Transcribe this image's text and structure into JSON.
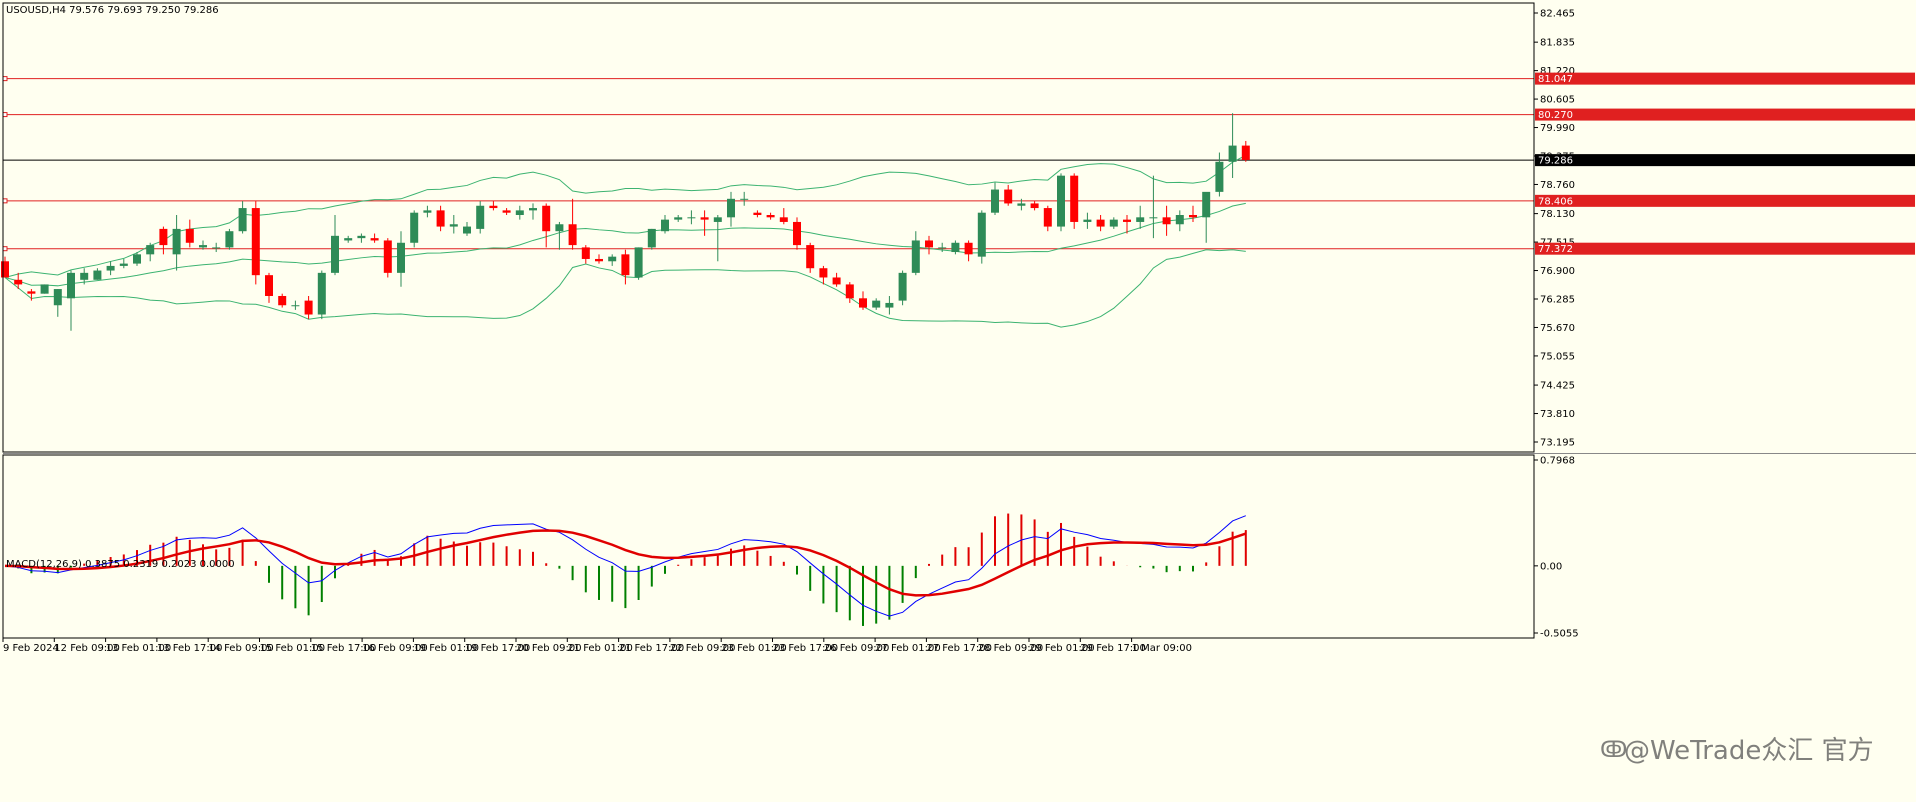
{
  "window": {
    "header": "USOUSD,H4  79.576 79.693 79.250 79.286",
    "macd_header": "MACD(12,26,9) 0.3875 0.2319 0.2023 0.0000",
    "watermark": "@WeTrade众汇 官方"
  },
  "colors": {
    "background": "#fffff0",
    "bull_candle": "#2e8b57",
    "bear_candle": "#ff0000",
    "bands": "#3cb371",
    "level_line": "#e02020",
    "macd_line": "#0000ff",
    "signal_line": "#e00000",
    "histogram_pos": "#e00000",
    "histogram_neg": "#008000"
  },
  "chart_data": [
    {
      "type": "candlestick",
      "symbol": "USOUSD",
      "timeframe": "H4",
      "ohlc_last": {
        "open": 79.576,
        "high": 79.693,
        "low": 79.25,
        "close": 79.286
      },
      "y_ticks": [
        "82.465",
        "81.835",
        "81.220",
        "80.605",
        "79.990",
        "79.375",
        "78.760",
        "78.130",
        "77.515",
        "76.900",
        "76.285",
        "75.670",
        "75.055",
        "74.425",
        "73.810",
        "73.195"
      ],
      "ylim": [
        73.195,
        82.465
      ],
      "price_labels": [
        {
          "label": "81.047",
          "value": 81.047,
          "kind": "level"
        },
        {
          "label": "80.270",
          "value": 80.27,
          "kind": "level"
        },
        {
          "label": "79.286",
          "value": 79.286,
          "kind": "current"
        },
        {
          "label": "78.406",
          "value": 78.406,
          "kind": "level"
        },
        {
          "label": "77.372",
          "value": 77.372,
          "kind": "level"
        }
      ],
      "x_labels": [
        "9 Feb 2024",
        "12 Feb 09:00",
        "13 Feb 01:00",
        "13 Feb 17:00",
        "14 Feb 09:00",
        "15 Feb 01:00",
        "15 Feb 17:00",
        "16 Feb 09:00",
        "19 Feb 01:00",
        "19 Feb 17:00",
        "20 Feb 09:00",
        "21 Feb 01:00",
        "21 Feb 17:00",
        "22 Feb 09:00",
        "23 Feb 01:00",
        "23 Feb 17:00",
        "26 Feb 09:00",
        "27 Feb 01:00",
        "27 Feb 17:00",
        "28 Feb 09:00",
        "29 Feb 01:00",
        "29 Feb 17:00",
        "1 Mar 09:00"
      ],
      "candles": [
        [
          77.1,
          77.2,
          76.75,
          76.75
        ],
        [
          76.7,
          76.85,
          76.5,
          76.6
        ],
        [
          76.45,
          76.5,
          76.25,
          76.4
        ],
        [
          76.4,
          76.6,
          76.4,
          76.6
        ],
        [
          76.15,
          76.5,
          75.9,
          76.5
        ],
        [
          76.3,
          76.9,
          75.6,
          76.85
        ],
        [
          76.7,
          76.95,
          76.6,
          76.85
        ],
        [
          76.7,
          76.95,
          76.7,
          76.9
        ],
        [
          76.9,
          77.1,
          76.8,
          77.0
        ],
        [
          77.0,
          77.15,
          76.95,
          77.05
        ],
        [
          77.05,
          77.3,
          77.0,
          77.25
        ],
        [
          77.25,
          77.5,
          77.1,
          77.45
        ],
        [
          77.8,
          77.85,
          77.25,
          77.45
        ],
        [
          77.25,
          78.1,
          76.9,
          77.8
        ],
        [
          77.8,
          78.0,
          77.4,
          77.5
        ],
        [
          77.4,
          77.55,
          77.35,
          77.45
        ],
        [
          77.4,
          77.5,
          77.3,
          77.4
        ],
        [
          77.4,
          77.8,
          77.35,
          77.75
        ],
        [
          77.75,
          78.4,
          77.7,
          78.25
        ],
        [
          78.25,
          78.4,
          76.6,
          76.8
        ],
        [
          76.8,
          76.85,
          76.2,
          76.35
        ],
        [
          76.35,
          76.4,
          76.1,
          76.15
        ],
        [
          76.15,
          76.25,
          76.05,
          76.15
        ],
        [
          76.25,
          76.35,
          75.85,
          75.95
        ],
        [
          75.95,
          76.9,
          75.85,
          76.85
        ],
        [
          76.85,
          78.1,
          76.8,
          77.65
        ],
        [
          77.55,
          77.65,
          77.5,
          77.6
        ],
        [
          77.6,
          77.7,
          77.5,
          77.65
        ],
        [
          77.6,
          77.7,
          77.5,
          77.55
        ],
        [
          77.55,
          77.6,
          76.75,
          76.85
        ],
        [
          76.85,
          77.75,
          76.55,
          77.5
        ],
        [
          77.5,
          78.2,
          77.4,
          78.15
        ],
        [
          78.15,
          78.3,
          78.05,
          78.2
        ],
        [
          78.2,
          78.3,
          77.75,
          77.85
        ],
        [
          77.85,
          78.1,
          77.7,
          77.9
        ],
        [
          77.7,
          77.95,
          77.65,
          77.85
        ],
        [
          77.8,
          78.4,
          77.7,
          78.3
        ],
        [
          78.3,
          78.4,
          78.2,
          78.25
        ],
        [
          78.2,
          78.25,
          78.1,
          78.15
        ],
        [
          78.1,
          78.3,
          78.0,
          78.2
        ],
        [
          78.2,
          78.35,
          78.0,
          78.25
        ],
        [
          78.3,
          78.35,
          77.4,
          77.75
        ],
        [
          77.75,
          77.95,
          77.35,
          77.9
        ],
        [
          77.9,
          78.45,
          77.35,
          77.45
        ],
        [
          77.4,
          77.45,
          77.05,
          77.15
        ],
        [
          77.15,
          77.25,
          77.05,
          77.1
        ],
        [
          77.1,
          77.25,
          77.0,
          77.2
        ],
        [
          77.25,
          77.35,
          76.6,
          76.8
        ],
        [
          76.75,
          77.4,
          76.7,
          77.4
        ],
        [
          77.4,
          77.8,
          77.35,
          77.8
        ],
        [
          77.75,
          78.1,
          77.7,
          78.0
        ],
        [
          78.0,
          78.1,
          77.95,
          78.05
        ],
        [
          78.05,
          78.2,
          77.9,
          78.05
        ],
        [
          78.05,
          78.2,
          77.65,
          78.0
        ],
        [
          77.95,
          78.1,
          77.1,
          78.05
        ],
        [
          78.05,
          78.6,
          77.85,
          78.45
        ],
        [
          78.45,
          78.6,
          78.3,
          78.45
        ],
        [
          78.15,
          78.2,
          78.05,
          78.1
        ],
        [
          78.1,
          78.15,
          78.0,
          78.05
        ],
        [
          78.05,
          78.25,
          77.9,
          77.95
        ],
        [
          77.95,
          78.05,
          77.35,
          77.45
        ],
        [
          77.45,
          77.5,
          76.85,
          76.95
        ],
        [
          76.95,
          77.0,
          76.6,
          76.75
        ],
        [
          76.75,
          76.85,
          76.55,
          76.6
        ],
        [
          76.6,
          76.65,
          76.2,
          76.3
        ],
        [
          76.3,
          76.45,
          76.05,
          76.1
        ],
        [
          76.1,
          76.3,
          76.05,
          76.25
        ],
        [
          76.1,
          76.35,
          75.95,
          76.2
        ],
        [
          76.25,
          76.9,
          76.15,
          76.85
        ],
        [
          76.85,
          77.75,
          76.8,
          77.55
        ],
        [
          77.55,
          77.65,
          77.25,
          77.4
        ],
        [
          77.4,
          77.5,
          77.3,
          77.4
        ],
        [
          77.3,
          77.55,
          77.25,
          77.5
        ],
        [
          77.5,
          77.55,
          77.1,
          77.25
        ],
        [
          77.2,
          78.2,
          77.05,
          78.15
        ],
        [
          78.15,
          78.8,
          78.1,
          78.65
        ],
        [
          78.65,
          78.75,
          78.3,
          78.35
        ],
        [
          78.3,
          78.45,
          78.2,
          78.35
        ],
        [
          78.35,
          78.4,
          78.2,
          78.25
        ],
        [
          78.25,
          78.3,
          77.75,
          77.85
        ],
        [
          77.85,
          79.0,
          77.75,
          78.95
        ],
        [
          78.95,
          79.0,
          77.8,
          77.95
        ],
        [
          77.95,
          78.15,
          77.8,
          78.0
        ],
        [
          78.0,
          78.1,
          77.75,
          77.85
        ],
        [
          77.85,
          78.05,
          77.8,
          78.0
        ],
        [
          78.0,
          78.1,
          77.7,
          77.95
        ],
        [
          77.95,
          78.3,
          77.8,
          78.05
        ],
        [
          78.05,
          78.95,
          77.6,
          78.05
        ],
        [
          78.05,
          78.3,
          77.65,
          77.9
        ],
        [
          77.9,
          78.2,
          77.75,
          78.1
        ],
        [
          78.1,
          78.3,
          77.95,
          78.05
        ],
        [
          78.05,
          78.5,
          77.5,
          78.6
        ],
        [
          78.6,
          79.45,
          78.5,
          79.25
        ],
        [
          79.25,
          80.3,
          78.9,
          79.6
        ],
        [
          79.6,
          79.7,
          79.25,
          79.29
        ]
      ]
    },
    {
      "type": "line",
      "indicator": "MACD(12,26,9)",
      "values_header": [
        0.3875,
        0.2319,
        0.2023,
        0.0
      ],
      "y_ticks": [
        "0.7968",
        "0.00",
        "-0.5055"
      ],
      "ylim": [
        -0.5055,
        0.7968
      ]
    }
  ]
}
